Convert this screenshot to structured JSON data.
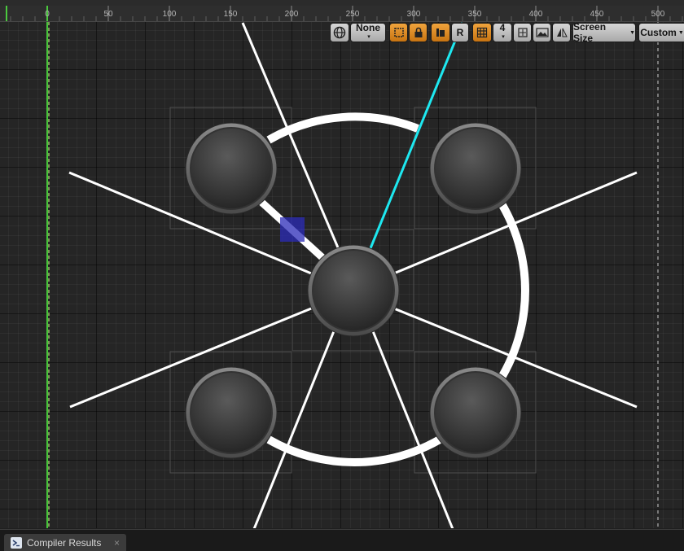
{
  "ruler": {
    "ticks": [
      "0",
      "50",
      "100",
      "150",
      "200",
      "250",
      "300",
      "350",
      "400",
      "450",
      "500"
    ]
  },
  "toolbar": {
    "world_icon": "globe-icon",
    "dpi_select": "None",
    "rotate_label": "R",
    "grid_snap_value": "4",
    "screen_size_label": "Screen Size",
    "custom_label": "Custom"
  },
  "bottom_tab": {
    "label": "Compiler Results",
    "close": "×"
  },
  "colors": {
    "canvas_bg": "#252525",
    "guide_green": "#55ff44",
    "selected_line": "#1ee8f0",
    "toolbar_active": "#e69524",
    "selection_box": "#2b2bb8"
  }
}
